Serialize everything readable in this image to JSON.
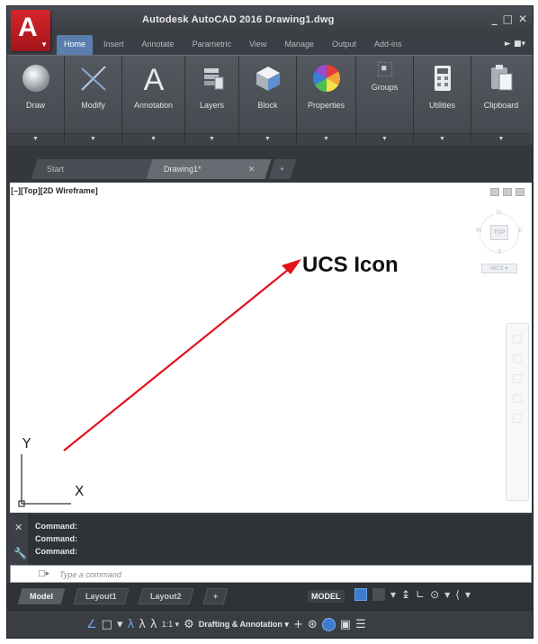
{
  "window": {
    "title": "Autodesk AutoCAD 2016   Drawing1.dwg",
    "controls": [
      "_",
      "□",
      "✕"
    ]
  },
  "app_logo": {
    "letter": "A",
    "icon": "autocad-logo-icon"
  },
  "ribbon_tabs": [
    "Home",
    "Insert",
    "Annotate",
    "Parametric",
    "View",
    "Manage",
    "Output",
    "Add-ins"
  ],
  "ribbon_tab_extra": "► ■▾",
  "ribbon_panels": [
    {
      "label": "Draw",
      "icon": "draw-sphere-icon"
    },
    {
      "label": "Modify",
      "icon": "modify-icon"
    },
    {
      "label": "Annotation",
      "icon": "annotation-text-icon"
    },
    {
      "label": "Layers",
      "icon": "layers-icon"
    },
    {
      "label": "Block",
      "icon": "block-icon"
    },
    {
      "label": "Properties",
      "icon": "properties-color-wheel-icon"
    },
    {
      "label": "Groups",
      "icon": "groups-icon"
    },
    {
      "label": "Utilities",
      "icon": "utilities-calculator-icon"
    },
    {
      "label": "Clipboard",
      "icon": "clipboard-icon"
    }
  ],
  "doc_tabs": {
    "start": "Start",
    "drawing": "Drawing1*",
    "close": "✕",
    "new": "+"
  },
  "viewport": {
    "label": "[–][Top][2D Wireframe]",
    "viewcube": {
      "n": "N",
      "s": "S",
      "w": "W",
      "e": "E",
      "face": "TOP",
      "wcs": "WCS ▾"
    }
  },
  "ucs": {
    "y_label": "Y",
    "x_label": "X"
  },
  "annotation": {
    "label": "UCS Icon",
    "arrow_color": "#e3121b"
  },
  "command_history": [
    "Command:",
    "Command:",
    "Command:"
  ],
  "command_input": {
    "prompt_icon": "□▸",
    "placeholder": "Type a command"
  },
  "layout_tabs": [
    "Model",
    "Layout1",
    "Layout2",
    "+"
  ],
  "status": {
    "model_badge": "MODEL",
    "scale": "1:1 ▾",
    "workspace": "Drafting & Annotation ▾"
  },
  "colors": {
    "accent_blue": "#3d7bd1",
    "autocad_red": "#d8242b"
  }
}
